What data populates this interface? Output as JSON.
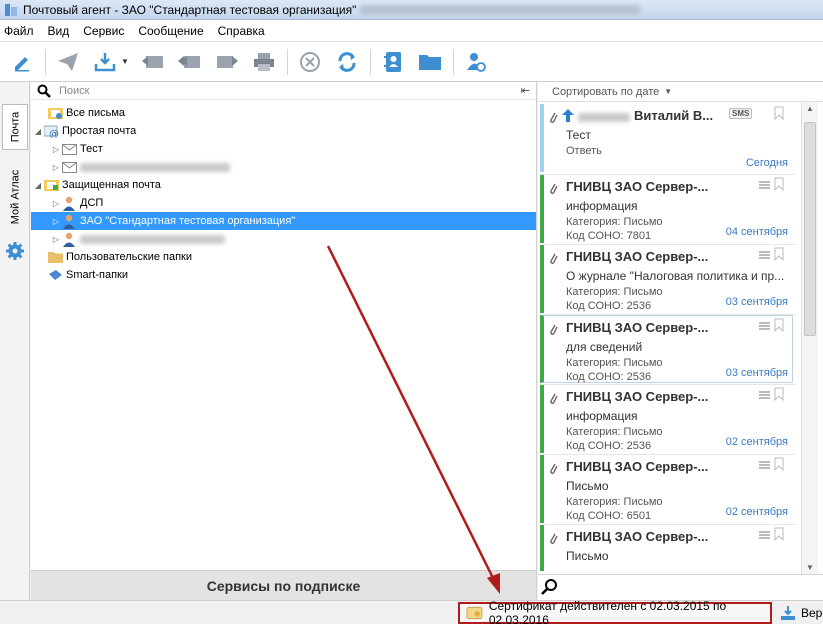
{
  "window": {
    "title": "Почтовый агент - ЗАО \"Стандартная тестовая организация\""
  },
  "menu": [
    "Файл",
    "Вид",
    "Сервис",
    "Сообщение",
    "Справка"
  ],
  "sidebar_tabs": {
    "mail": "Почта",
    "atlas": "Мой Атлас"
  },
  "search": {
    "placeholder": "Поиск"
  },
  "tree": {
    "all_mail": "Все письма",
    "simple_mail": "Простая почта",
    "test": "Тест",
    "secure_mail": "Защищенная почта",
    "dsp": "ДСП",
    "org": "ЗАО \"Стандартная тестовая организация\"",
    "user_folders": "Пользовательские папки",
    "smart_folders": "Smart-папки"
  },
  "services_label": "Сервисы по подписке",
  "sort_label": "Сортировать по дате",
  "messages": [
    {
      "sender": "Виталий В...",
      "badge": "SMS",
      "subject": "Тест",
      "status": "Ответь",
      "date": "Сегодня"
    },
    {
      "sender": "ГНИВЦ ЗАО Сервер-...",
      "subject": "информация",
      "cat_label": "Категория:",
      "category": "Письмо",
      "code_label": "Код СОНО:",
      "code": "7801",
      "date": "04 сентября"
    },
    {
      "sender": "ГНИВЦ ЗАО Сервер-...",
      "subject": "О журнале \"Налоговая политика и пр...",
      "cat_label": "Категория:",
      "category": "Письмо",
      "code_label": "Код СОНО:",
      "code": "2536",
      "date": "03 сентября"
    },
    {
      "sender": "ГНИВЦ ЗАО Сервер-...",
      "subject": "для сведений",
      "cat_label": "Категория:",
      "category": "Письмо",
      "code_label": "Код СОНО:",
      "code": "2536",
      "date": "03 сентября"
    },
    {
      "sender": "ГНИВЦ ЗАО Сервер-...",
      "subject": "информация",
      "cat_label": "Категория:",
      "category": "Письмо",
      "code_label": "Код СОНО:",
      "code": "2536",
      "date": "02 сентября"
    },
    {
      "sender": "ГНИВЦ ЗАО Сервер-...",
      "subject": "Письмо",
      "cat_label": "Категория:",
      "category": "Письмо",
      "code_label": "Код СОНО:",
      "code": "6501",
      "date": "02 сентября"
    },
    {
      "sender": "ГНИВЦ ЗАО Сервер-...",
      "subject": "Письмо"
    }
  ],
  "status": {
    "certificate": "Сертификат действителен с 02.03.2015 по 02.03.2016",
    "version": "Версия"
  },
  "colors": {
    "accent_green": "#3cab47",
    "selection": "#3399ff",
    "annotation_red": "#b01c1c"
  }
}
